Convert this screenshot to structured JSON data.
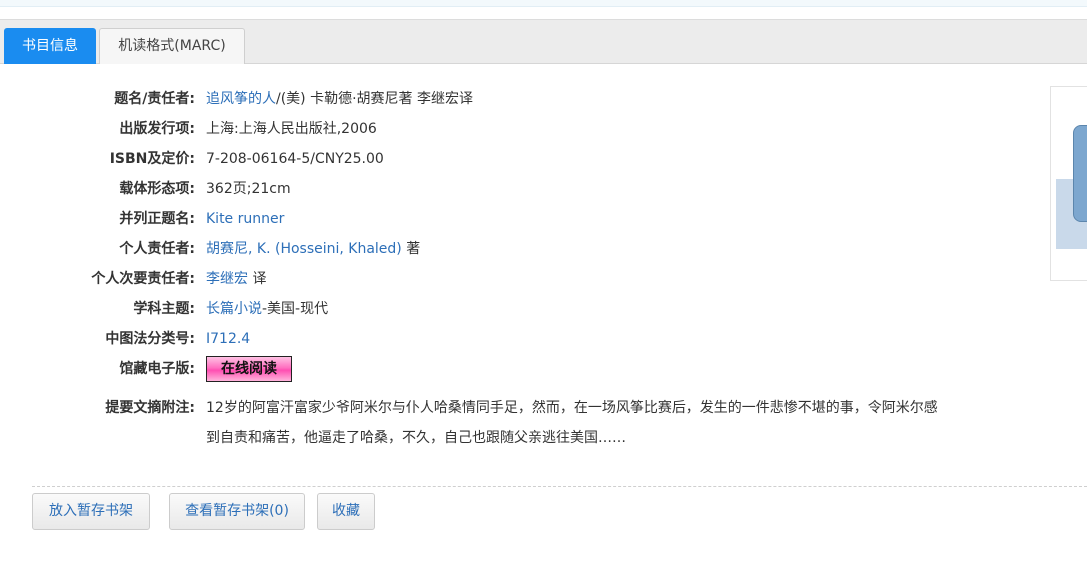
{
  "tabs": {
    "active": "书目信息",
    "marc": "机读格式(MARC)"
  },
  "fields": {
    "title_label": "题名/责任者:",
    "title_link": "追风筝的人",
    "title_rest": "/(美) 卡勒德·胡赛尼著 李继宏译",
    "publish_label": "出版发行项:",
    "publish_value": "上海:上海人民出版社,2006",
    "isbn_label": "ISBN及定价:",
    "isbn_value": "7-208-06164-5/CNY25.00",
    "physical_label": "载体形态项:",
    "physical_value": "362页;21cm",
    "parallel_label": "并列正题名:",
    "parallel_link": "Kite runner",
    "author_label": "个人责任者:",
    "author_link": "胡赛尼, K. (Hosseini, Khaled)",
    "author_role": "著",
    "secondary_label": "个人次要责任者:",
    "secondary_link": "李继宏",
    "secondary_role": "译",
    "subject_label": "学科主题:",
    "subject_link": "长篇小说",
    "subject_rest": "-美国-现代",
    "clc_label": "中图法分类号:",
    "clc_link": "I712.4",
    "ebook_label": "馆藏电子版:",
    "ebook_button": "在线阅读",
    "abstract_label": "提要文摘附注:",
    "abstract_value": "12岁的阿富汗富家少爷阿米尔与仆人哈桑情同手足，然而，在一场风筝比赛后，发生的一件悲惨不堪的事，令阿米尔感到自责和痛苦，他逼走了哈桑，不久，自己也跟随父亲逃往美国……"
  },
  "actions": {
    "add_shelf": "放入暂存书架",
    "view_shelf": "查看暂存书架(0)",
    "favorite": "收藏"
  },
  "colors": {
    "tab_active": "#1a8cf0",
    "link": "#2d6fb8",
    "ebook_pink": "#ff6fc0"
  }
}
